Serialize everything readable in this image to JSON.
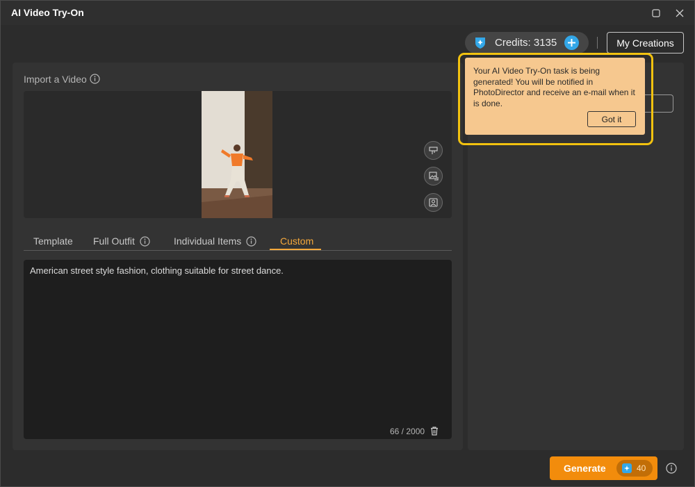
{
  "window": {
    "title": "AI Video Try-On"
  },
  "header": {
    "credits_label": "Credits: 3135",
    "my_creations_label": "My Creations"
  },
  "import": {
    "label": "Import a Video"
  },
  "tabs": [
    {
      "label": "Template",
      "active": false
    },
    {
      "label": "Full Outfit",
      "active": false
    },
    {
      "label": "Individual Items",
      "active": false
    },
    {
      "label": "Custom",
      "active": true
    }
  ],
  "prompt": {
    "text": "American street style fashion, clothing suitable for street dance.",
    "char_count": "66 / 2000"
  },
  "tooltip": {
    "message": "Your AI Video Try-On task is being generated! You will be notified in PhotoDirector and receive an e-mail when it is done.",
    "button_label": "Got it"
  },
  "generate": {
    "label": "Generate",
    "cost": "40"
  },
  "colors": {
    "accent": "#f5a83b",
    "generate": "#f28c0c",
    "credits_blue": "#33a7e8",
    "tooltip_bg": "#f6c88f",
    "highlight": "#f2c20f"
  },
  "icons": {
    "credits": "gem-icon",
    "add": "plus-icon",
    "maximize": "maximize-icon",
    "close": "close-icon",
    "info": "info-icon",
    "trash": "trash-icon",
    "side_tools": [
      "video-trim-icon",
      "replace-image-icon",
      "person-frame-icon"
    ]
  }
}
